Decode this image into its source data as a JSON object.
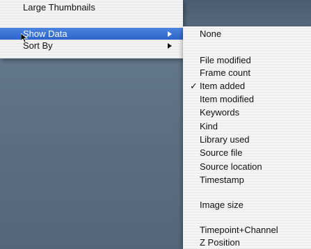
{
  "menu": {
    "items": [
      {
        "label": "Large Thumbnails",
        "has_submenu": false,
        "selected": false
      },
      {
        "label": "Show Data",
        "has_submenu": true,
        "selected": true
      },
      {
        "label": "Sort By",
        "has_submenu": true,
        "selected": false
      }
    ]
  },
  "submenu": {
    "items": [
      {
        "label": "None",
        "checked": false
      },
      {
        "label": "File modified",
        "checked": false
      },
      {
        "label": "Frame count",
        "checked": false
      },
      {
        "label": "Item added",
        "checked": true
      },
      {
        "label": "Item modified",
        "checked": false
      },
      {
        "label": "Keywords",
        "checked": false
      },
      {
        "label": "Kind",
        "checked": false
      },
      {
        "label": "Library used",
        "checked": false
      },
      {
        "label": "Source file",
        "checked": false
      },
      {
        "label": "Source location",
        "checked": false
      },
      {
        "label": "Timestamp",
        "checked": false
      },
      {
        "label": "Image size",
        "checked": false
      },
      {
        "label": "Timepoint+Channel",
        "checked": false
      },
      {
        "label": "Z Position",
        "checked": false
      }
    ],
    "check_glyph": "✓"
  }
}
